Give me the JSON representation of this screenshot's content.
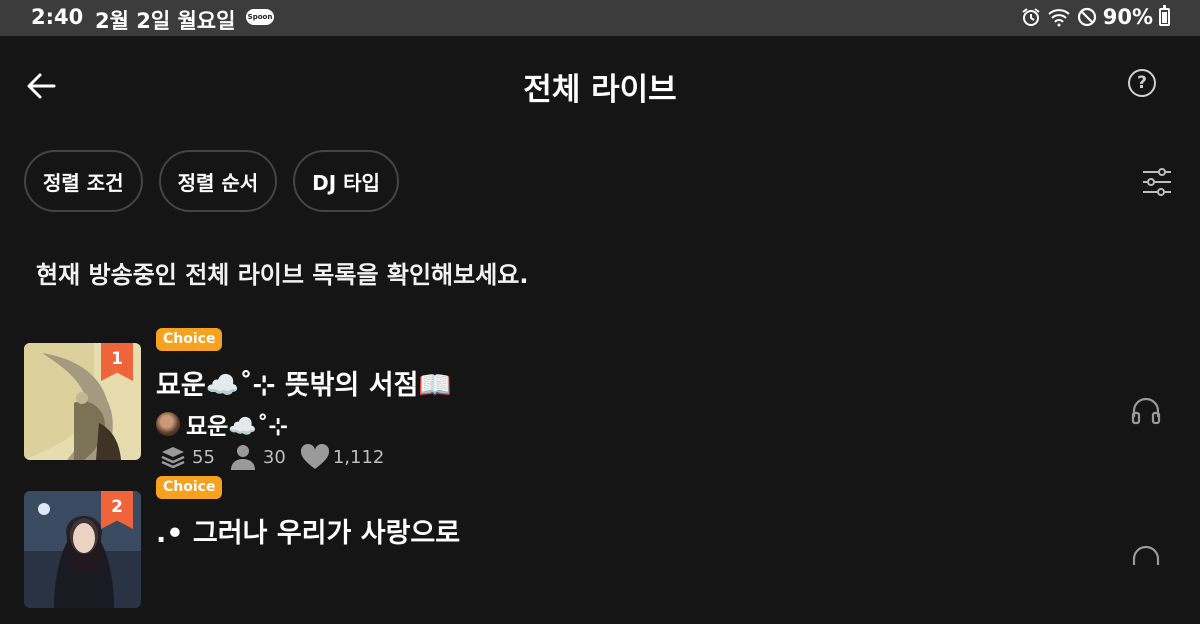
{
  "status_bar": {
    "time": "2:40",
    "date": "2월 2일 월요일",
    "app_badge": "Spoon",
    "battery": "90%"
  },
  "header": {
    "title": "전체 라이브",
    "help_label": "?"
  },
  "filters": {
    "chips": [
      "정렬 조건",
      "정렬 순서",
      "DJ 타입"
    ]
  },
  "subtitle": "현재 방송중인 전체 라이브 목록을 확인해보세요.",
  "lives": [
    {
      "rank": "1",
      "badge": "Choice",
      "title": "묘운☁️˚⊹ 뜻밖의 서점📖",
      "dj": "묘운☁️˚⊹",
      "stats": {
        "stack": "55",
        "listeners": "30",
        "likes": "1,112"
      }
    },
    {
      "rank": "2",
      "badge": "Choice",
      "title": ".• 그러나 우리가 사랑으로"
    }
  ],
  "colors": {
    "background": "#151515",
    "status_bar": "#3c3c3c",
    "choice_badge": "#f6a21e",
    "rank_flag": "#f0643c"
  },
  "icons": [
    "back-arrow-icon",
    "help-icon",
    "filter-sliders-icon",
    "stack-icon",
    "person-icon",
    "heart-icon",
    "headphones-icon",
    "alarm-icon",
    "wifi-icon",
    "dnd-icon",
    "battery-icon"
  ]
}
